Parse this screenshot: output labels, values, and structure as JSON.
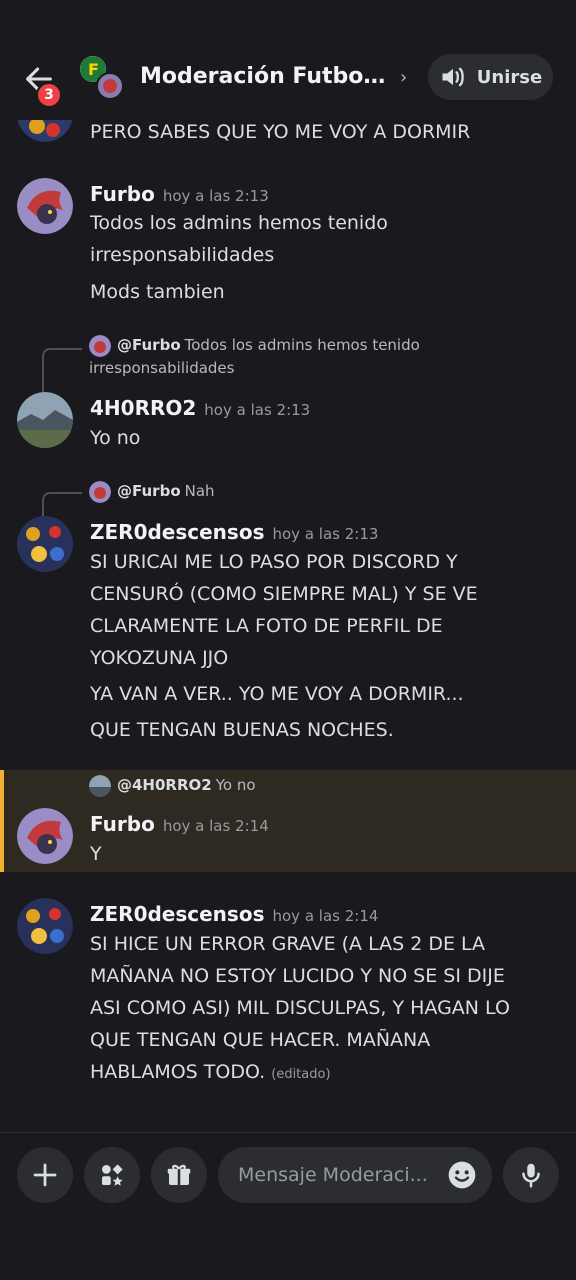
{
  "header": {
    "badge_count": "3",
    "title": "Moderación Futbola...",
    "join_label": "Unirse"
  },
  "messages": {
    "m0": {
      "line1": "PERO SABES QUE YO ME VOY A DORMIR"
    },
    "m1": {
      "author": "Furbo",
      "time": "hoy a las 2:13",
      "line1": "Todos los admins hemos tenido",
      "line2": "irresponsabilidades",
      "line3": "Mods tambien"
    },
    "m2": {
      "reply_author": "@Furbo",
      "reply_text1": "Todos los admins hemos tenido",
      "reply_text2": "irresponsabilidades",
      "author": "4H0RRO2",
      "time": "hoy a las 2:13",
      "line1": "Yo no"
    },
    "m3": {
      "reply_author": "@Furbo",
      "reply_text": "Nah",
      "author": "ZER0descensos",
      "time": "hoy a las 2:13",
      "line1": "SI URICAI ME LO PASO POR DISCORD Y",
      "line2": "CENSURÓ (COMO SIEMPRE MAL) Y SE VE",
      "line3": "CLARAMENTE LA FOTO DE PERFIL DE",
      "line4": "YOKOZUNA JJO",
      "line5": "YA VAN A VER.. YO ME VOY A DORMIR...",
      "line6": "QUE TENGAN BUENAS NOCHES."
    },
    "m4": {
      "reply_author": "@4H0RRO2",
      "reply_text": "Yo no",
      "author": "Furbo",
      "time": "hoy a las 2:14",
      "line1": "Y"
    },
    "m5": {
      "author": "ZER0descensos",
      "time": "hoy a las 2:14",
      "line1": "SI HICE UN ERROR GRAVE (A LAS 2 DE LA",
      "line2": "MAÑANA NO ESTOY LUCIDO Y NO SE SI DIJE",
      "line3": "ASI COMO ASI) MIL DISCULPAS, Y HAGAN LO",
      "line4": "QUE TENGAN QUE HACER. MAÑANA",
      "line5": "HABLAMOS TODO.",
      "edited": "(editado)"
    }
  },
  "composer": {
    "placeholder": "Mensaje Moderaci..."
  },
  "colors": {
    "background": "#1a1a1e",
    "accent_mention": "#f0b232",
    "badge": "#f23f43"
  }
}
